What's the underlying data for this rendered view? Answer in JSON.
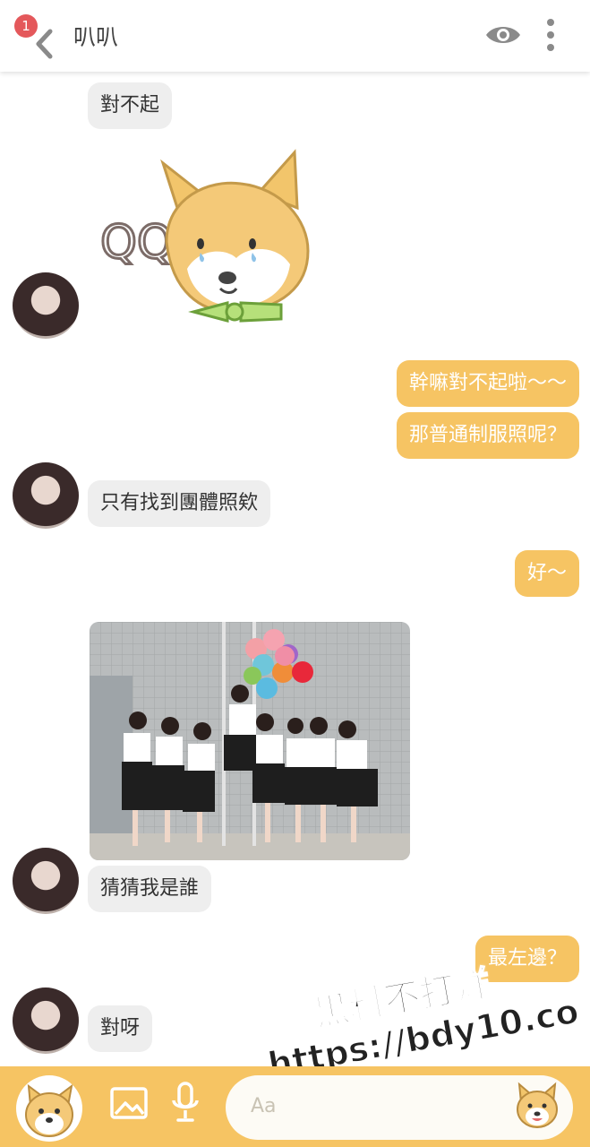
{
  "header": {
    "badge_count": "1",
    "title": "叭叭",
    "icons": {
      "back": "chevron-left-icon",
      "eye": "eye-icon",
      "more": "more-vertical-icon"
    }
  },
  "messages": [
    {
      "side": "in",
      "text": "對不起"
    },
    {
      "side": "in",
      "sticker": "shiba-crying-sticker",
      "sticker_text": "QQ"
    },
    {
      "side": "out",
      "text": "幹嘛對不起啦～～"
    },
    {
      "side": "out",
      "text": "那普通制服照呢？"
    },
    {
      "side": "in",
      "text": "只有找到團體照欸"
    },
    {
      "side": "out",
      "text": "好～"
    },
    {
      "side": "in",
      "image": "group-photo"
    },
    {
      "side": "in",
      "text": "猜猜我是誰"
    },
    {
      "side": "out",
      "text": "最左邊？"
    },
    {
      "side": "in",
      "text": "對呀"
    }
  ],
  "composer": {
    "placeholder": "Aa",
    "icons": {
      "profile": "shiba-avatar-icon",
      "image": "image-icon",
      "mic": "microphone-icon",
      "sticker": "shiba-sticker-icon"
    }
  },
  "watermark": {
    "line1": "黑料不打烊",
    "line2": "https://bdy10.co"
  },
  "colors": {
    "accent": "#f6c463",
    "incoming_bubble": "#eeeeee",
    "badge": "#e4585b"
  }
}
